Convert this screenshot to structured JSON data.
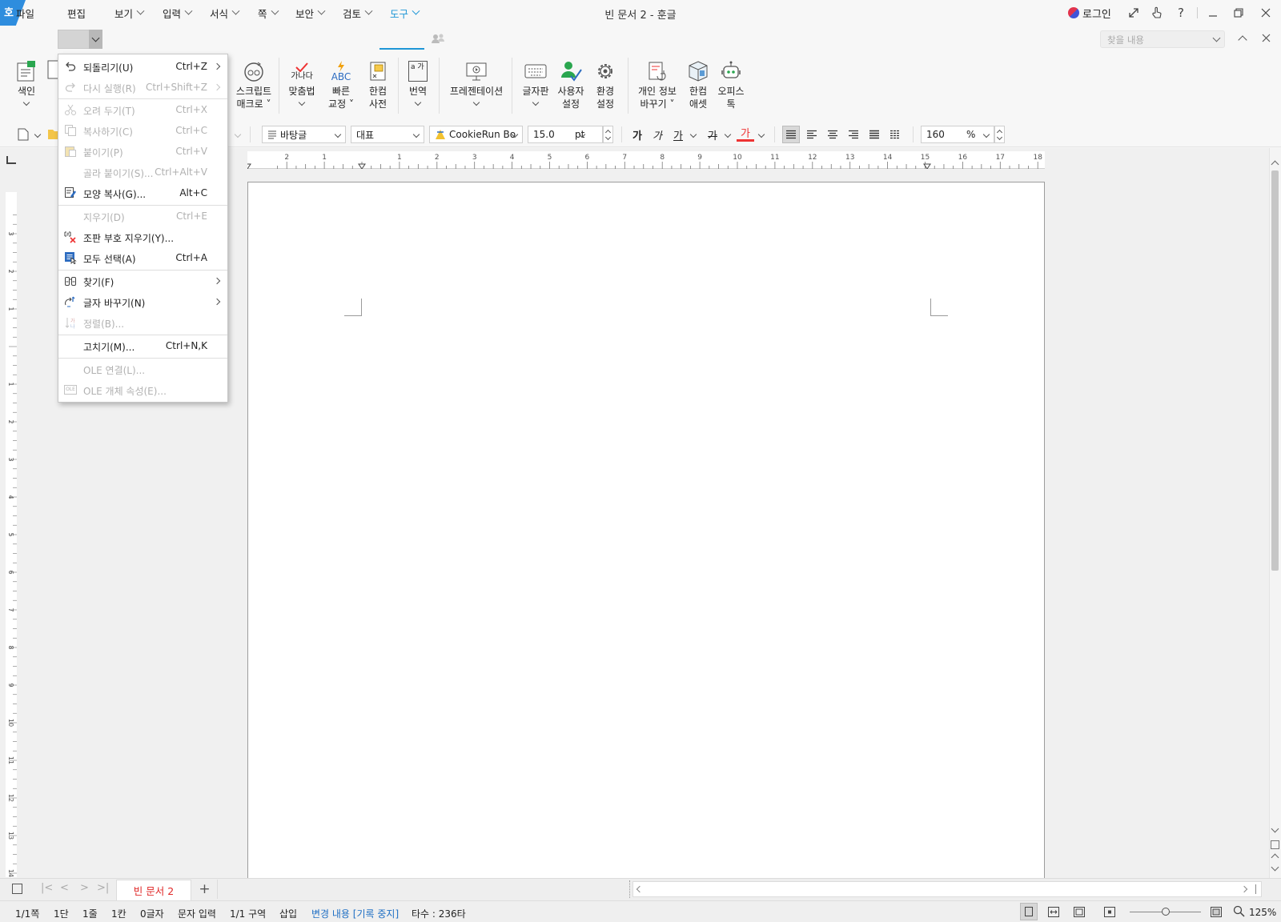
{
  "app": {
    "logo_glyph": "호",
    "window_title": "빈 문서 2 - 훈글",
    "login_label": "로그인"
  },
  "menubar": {
    "items": [
      "파일",
      "편집",
      "보기",
      "입력",
      "서식",
      "쪽",
      "보안",
      "검토",
      "도구"
    ],
    "active": "편집",
    "selected_tab": "도구",
    "search_placeholder": "찾을 내용"
  },
  "ribbon": {
    "items": [
      {
        "line1": "색인",
        "line2": ""
      },
      {
        "line1": "스크립트",
        "line2": "매크로"
      },
      {
        "line1": "맞춤법",
        "line2": ""
      },
      {
        "line1": "빠른",
        "line2": "교정"
      },
      {
        "line1": "한컴",
        "line2": "사전"
      },
      {
        "line1": "번역",
        "line2": ""
      },
      {
        "line1": "프레젠테이션",
        "line2": ""
      },
      {
        "line1": "글자판",
        "line2": ""
      },
      {
        "line1": "사용자",
        "line2": "설정"
      },
      {
        "line1": "환경",
        "line2": "설정"
      },
      {
        "line1": "개인 정보",
        "line2": "바꾸기"
      },
      {
        "line1": "한컴",
        "line2": "애셋"
      },
      {
        "line1": "오피스",
        "line2": "톡"
      }
    ],
    "spell_glyph": "가나다",
    "abc_glyph": "ABC",
    "translate_glyph": "a 가"
  },
  "format_bar": {
    "style": "바탕글",
    "language": "대표",
    "font": "CookieRun Bo",
    "size": "15.0",
    "size_unit": "pt",
    "char_buttons": [
      "가",
      "가",
      "가",
      "가",
      "가"
    ],
    "zoom_value": "160",
    "zoom_unit": "%"
  },
  "ruler": {
    "h_numbers": [
      "2",
      "1",
      "1",
      "2",
      "3",
      "4",
      "5",
      "6",
      "7",
      "8",
      "9",
      "10",
      "11",
      "12",
      "13",
      "14",
      "15",
      "16",
      "17",
      "18"
    ],
    "v_numbers": [
      "3",
      "2",
      "1",
      "1",
      "2",
      "3",
      "4",
      "5",
      "6",
      "7",
      "8",
      "9",
      "10",
      "11",
      "12",
      "13",
      "14"
    ]
  },
  "edit_menu": {
    "items": [
      {
        "label": "되돌리기(U)",
        "shortcut": "Ctrl+Z",
        "submenu": true,
        "enabled": true,
        "icon": "undo-icon"
      },
      {
        "label": "다시 실행(R)",
        "shortcut": "Ctrl+Shift+Z",
        "submenu": true,
        "enabled": false,
        "icon": "redo-icon"
      },
      {
        "label": "오려 두기(T)",
        "shortcut": "Ctrl+X",
        "submenu": false,
        "enabled": false,
        "icon": "cut-icon"
      },
      {
        "label": "복사하기(C)",
        "shortcut": "Ctrl+C",
        "submenu": false,
        "enabled": false,
        "icon": "copy-icon"
      },
      {
        "label": "붙이기(P)",
        "shortcut": "Ctrl+V",
        "submenu": false,
        "enabled": false,
        "icon": "paste-icon"
      },
      {
        "label": "골라 붙이기(S)...",
        "shortcut": "Ctrl+Alt+V",
        "submenu": false,
        "enabled": false,
        "icon": ""
      },
      {
        "label": "모양 복사(G)...",
        "shortcut": "Alt+C",
        "submenu": false,
        "enabled": true,
        "icon": "format-painter-icon"
      },
      {
        "label": "지우기(D)",
        "shortcut": "Ctrl+E",
        "submenu": false,
        "enabled": false,
        "icon": ""
      },
      {
        "label": "조판 부호 지우기(Y)...",
        "shortcut": "",
        "submenu": false,
        "enabled": true,
        "icon": "clear-markup-icon"
      },
      {
        "label": "모두 선택(A)",
        "shortcut": "Ctrl+A",
        "submenu": false,
        "enabled": true,
        "icon": "select-all-icon"
      },
      {
        "label": "찾기(F)",
        "shortcut": "",
        "submenu": true,
        "enabled": true,
        "icon": "binoculars-icon"
      },
      {
        "label": "글자 바꾸기(N)",
        "shortcut": "",
        "submenu": true,
        "enabled": true,
        "icon": "replace-icon"
      },
      {
        "label": "정렬(B)...",
        "shortcut": "",
        "submenu": false,
        "enabled": false,
        "icon": "sort-icon"
      },
      {
        "label": "고치기(M)...",
        "shortcut": "Ctrl+N,K",
        "submenu": false,
        "enabled": true,
        "icon": ""
      },
      {
        "label": "OLE 연결(L)...",
        "shortcut": "",
        "submenu": false,
        "enabled": false,
        "icon": ""
      },
      {
        "label": "OLE 개체 속성(E)...",
        "shortcut": "",
        "submenu": false,
        "enabled": false,
        "icon": "ole-icon"
      }
    ],
    "ole_icon_text": "OLE"
  },
  "tabs": {
    "document_tab": "빈 문서 2",
    "add_tab": "+"
  },
  "status_bar": {
    "page": "1/1쪽",
    "column": "1단",
    "line": "1줄",
    "cell": "1칸",
    "chars": "0글자",
    "mode": "문자 입력",
    "section": "1/1 구역",
    "insert": "삽입",
    "track_changes": "변경 내용 [기록 중지]",
    "typing": "타수 : 236타",
    "zoom": "125%",
    "zoom_slider_fraction": 0.5
  },
  "colors": {
    "accent_blue": "#1e96d6",
    "doc_tab_red": "#e02828",
    "track_changes_blue": "#1f6fc4",
    "logo_blue": "#2e8dde"
  }
}
